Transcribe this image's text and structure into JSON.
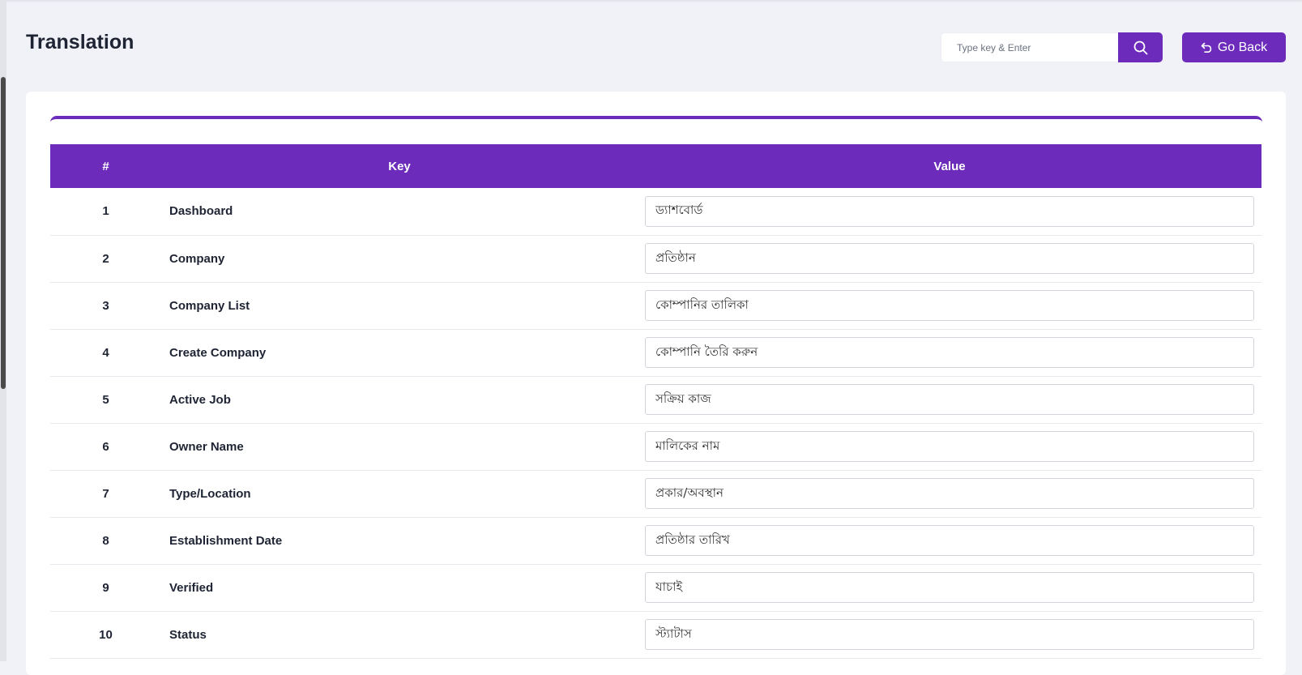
{
  "page": {
    "title": "Translation"
  },
  "search": {
    "placeholder": "Type key & Enter",
    "value": ""
  },
  "back_button": {
    "label": "Go Back"
  },
  "table": {
    "headers": {
      "num": "#",
      "key": "Key",
      "value": "Value"
    },
    "rows": [
      {
        "num": "1",
        "key": "Dashboard",
        "value": "ড্যাশবোর্ড"
      },
      {
        "num": "2",
        "key": "Company",
        "value": "প্রতিষ্ঠান"
      },
      {
        "num": "3",
        "key": "Company List",
        "value": "কোম্পানির তালিকা"
      },
      {
        "num": "4",
        "key": "Create Company",
        "value": "কোম্পানি তৈরি করুন"
      },
      {
        "num": "5",
        "key": "Active Job",
        "value": "সক্রিয় কাজ"
      },
      {
        "num": "6",
        "key": "Owner Name",
        "value": "মালিকের নাম"
      },
      {
        "num": "7",
        "key": "Type/Location",
        "value": "প্রকার/অবস্থান"
      },
      {
        "num": "8",
        "key": "Establishment Date",
        "value": "প্রতিষ্ঠার তারিখ"
      },
      {
        "num": "9",
        "key": "Verified",
        "value": "যাচাই"
      },
      {
        "num": "10",
        "key": "Status",
        "value": "স্ট্যাটাস"
      }
    ]
  },
  "colors": {
    "accent": "#6c2bba",
    "background": "#f1f2f7",
    "card": "#ffffff"
  },
  "icons": {
    "search": "search-icon",
    "back": "undo-arrow-icon"
  }
}
